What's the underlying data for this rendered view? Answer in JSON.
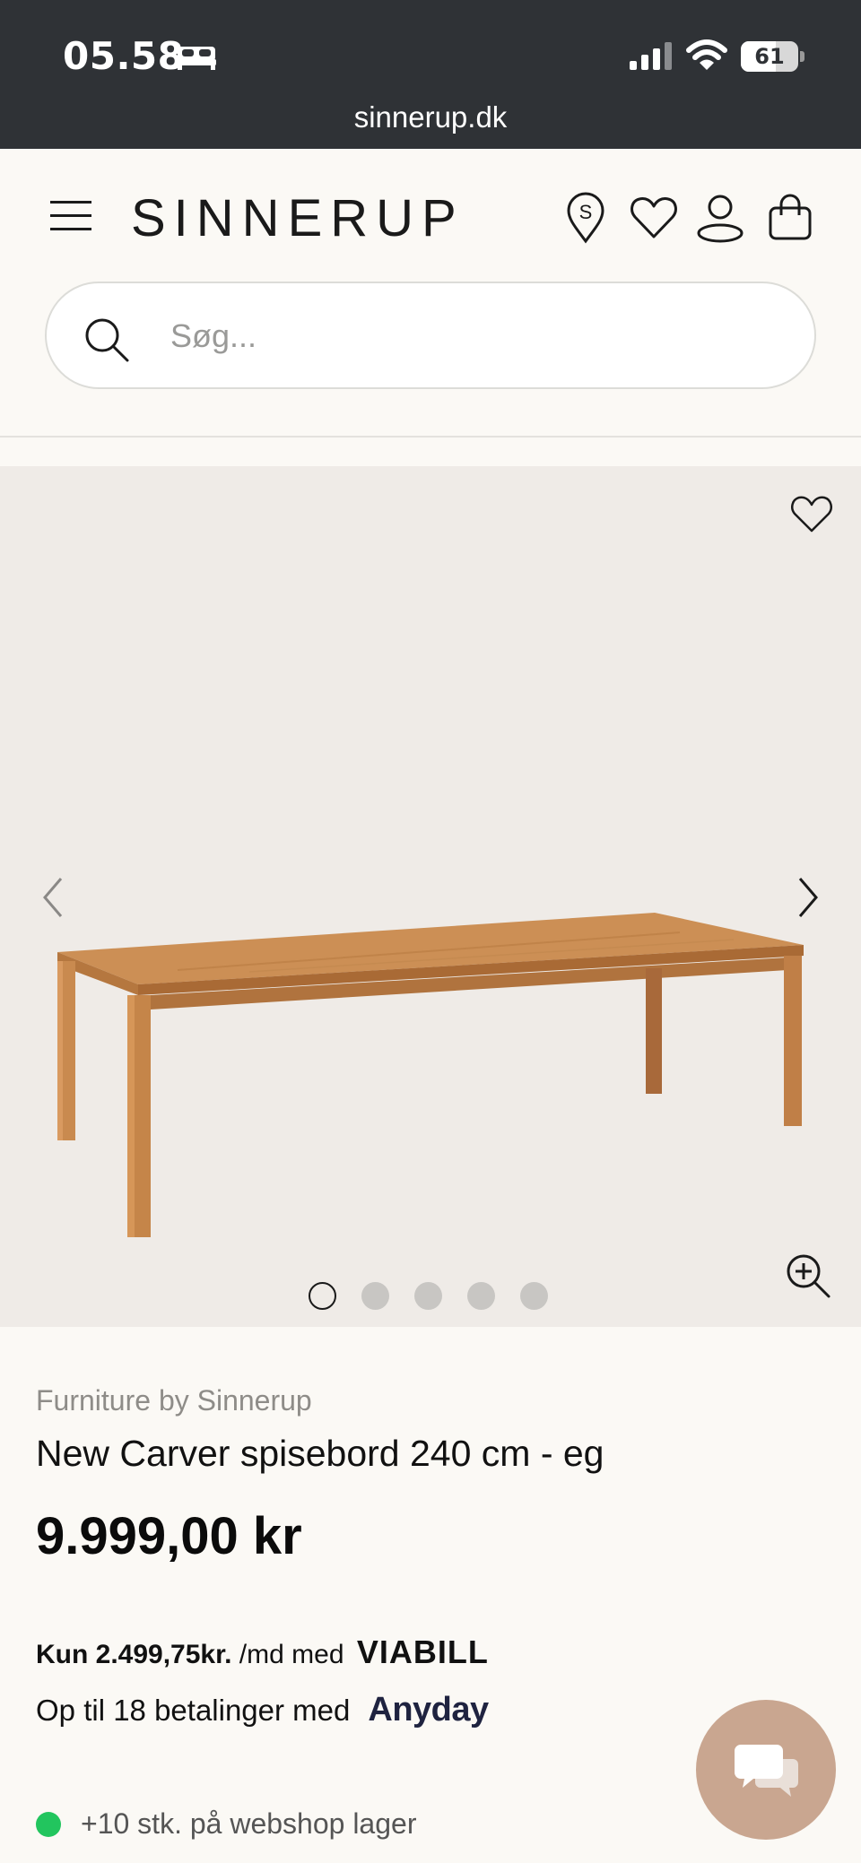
{
  "status_bar": {
    "time": "05.58",
    "battery_percent": "61",
    "battery_level": 0.61,
    "url": "sinnerup.dk",
    "icons": [
      "bed-icon",
      "signal-icon",
      "wifi-icon",
      "battery-icon"
    ]
  },
  "header": {
    "brand": "SINNERUP",
    "icons": [
      "menu-icon",
      "store-locator-icon",
      "heart-icon",
      "user-icon",
      "bag-icon"
    ]
  },
  "search": {
    "placeholder": "Søg..."
  },
  "gallery": {
    "slide_count": 5,
    "active_slide": 1,
    "icons": [
      "favorite-icon",
      "chevron-left-icon",
      "chevron-right-icon",
      "zoom-in-icon"
    ]
  },
  "product": {
    "vendor": "Furniture by Sinnerup",
    "title": "New Carver spisebord 240 cm - eg",
    "price": "9.999,00 kr"
  },
  "payment": {
    "viabill_prefix": "Kun 2.499,75kr.",
    "viabill_middle": " /md med ",
    "viabill_logo": "VIABILL",
    "anyday_text": "Op til 18 betalinger med",
    "anyday_logo": "Anyday"
  },
  "stock": {
    "text": "+10 stk. på webshop lager",
    "status_color": "#22c55e"
  },
  "colors": {
    "status_bar_bg": "#2f3236",
    "page_bg": "#fbf9f5",
    "gallery_bg": "#efebe7",
    "chat_bg": "#c9a690"
  }
}
